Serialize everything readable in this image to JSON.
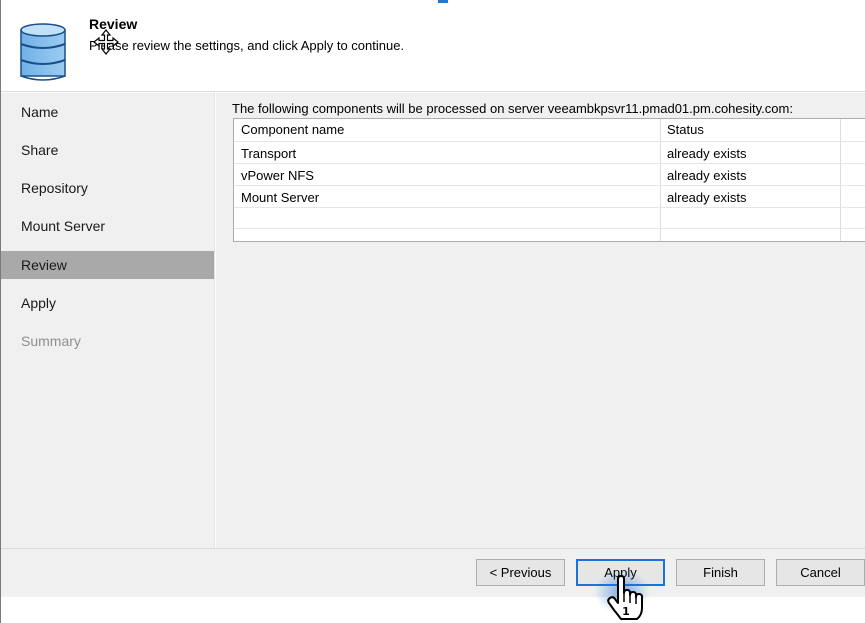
{
  "header": {
    "title": "Review",
    "subtitle": "Please review the settings, and click Apply to continue.",
    "icon": "database-icon"
  },
  "sidebar": {
    "items": [
      {
        "label": "Name",
        "state": "normal"
      },
      {
        "label": "Share",
        "state": "normal"
      },
      {
        "label": "Repository",
        "state": "normal"
      },
      {
        "label": "Mount Server",
        "state": "normal"
      },
      {
        "label": "Review",
        "state": "active"
      },
      {
        "label": "Apply",
        "state": "normal"
      },
      {
        "label": "Summary",
        "state": "disabled"
      }
    ]
  },
  "main": {
    "info": "The following components will be processed on server veeambkpsvr11.pmad01.pm.cohesity.com:",
    "table": {
      "columns": [
        "Component name",
        "Status"
      ],
      "rows": [
        [
          "Transport",
          "already exists"
        ],
        [
          "vPower NFS",
          "already exists"
        ],
        [
          "Mount Server",
          "already exists"
        ]
      ]
    }
  },
  "footer": {
    "previous_label": "< Previous",
    "apply_label": "Apply",
    "finish_label": "Finish",
    "cancel_label": "Cancel"
  },
  "overlay": {
    "click_badge": "1"
  },
  "colors": {
    "accent": "#1a73d9",
    "sidebar_bg": "#f0f0f0",
    "active_item_bg": "#a9a9a9"
  }
}
